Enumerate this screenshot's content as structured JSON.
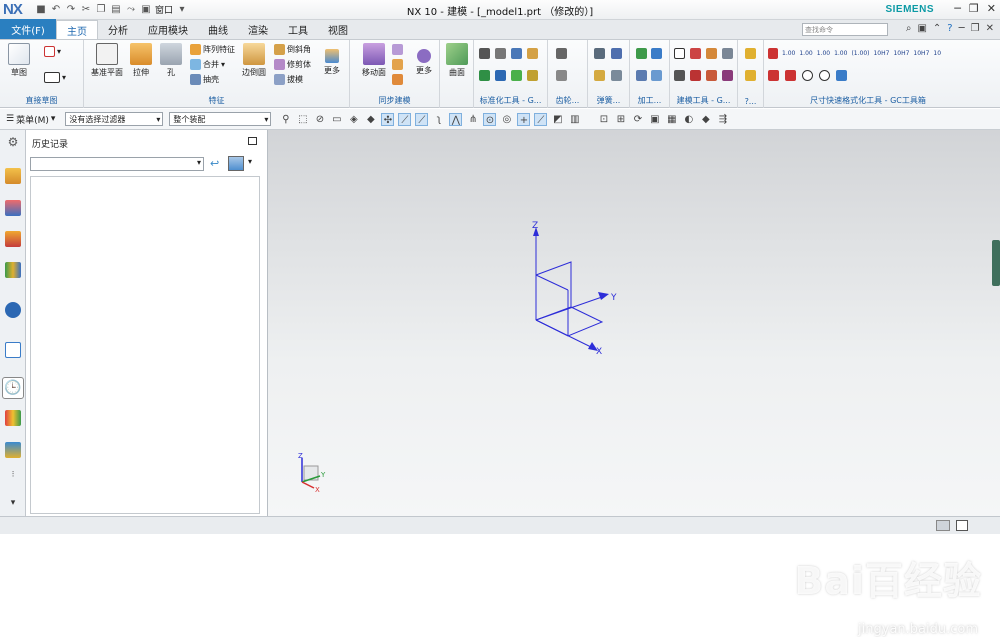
{
  "app": {
    "logo": "NX",
    "window_title": "NX 10 - 建模 - [_model1.prt （修改的）]",
    "brand": "SIEMENS",
    "window_menu_label": "窗口"
  },
  "tabs": {
    "file": "文件(F)",
    "items": [
      "主页",
      "分析",
      "应用模块",
      "曲线",
      "渲染",
      "工具",
      "视图"
    ],
    "active": "主页"
  },
  "command_search": {
    "placeholder": "查找命令"
  },
  "ribbon": {
    "sketch_group": {
      "label": "直接草图",
      "sketch_btn": "草图"
    },
    "feature_group": {
      "label": "特征",
      "datum_plane": "基准平面",
      "extrude": "拉伸",
      "hole": "孔",
      "pattern": "阵列特征",
      "unite": "合并",
      "shell": "抽壳",
      "edge_blend": "边倒圆",
      "chamfer": "倒斜角",
      "trim_body": "修剪体",
      "draft": "拔模",
      "more": "更多"
    },
    "sync_group": {
      "label": "同步建模",
      "move_face": "移动面",
      "more": "更多"
    },
    "surface_group": {
      "surface": "曲面"
    },
    "std_tools_label": "标准化工具 - G...",
    "gear_label": "齿轮...",
    "spring_label": "弹簧...",
    "machining_label": "加工...",
    "modeling_tools_label": "建模工具 - G...",
    "more_label": "?...",
    "dim_label": "尺寸快速格式化工具 - GC工具箱",
    "dim_values": [
      "1.00",
      "1.00",
      "1.00",
      "1.00",
      "(1.00)",
      "10H7",
      "10H7",
      "10H7",
      "10"
    ]
  },
  "toolbar": {
    "menu": "菜单(M)",
    "filter": "没有选择过滤器",
    "assembly": "整个装配"
  },
  "history_panel": {
    "title": "历史记录"
  },
  "triad": {
    "x": "X",
    "y": "Y",
    "z": "Z"
  },
  "mini_triad": {
    "x": "X",
    "y": "Y",
    "z": "Z"
  },
  "watermark": {
    "text": "Bai百经验",
    "url": "jingyan.baidu.com"
  },
  "colors": {
    "accent": "#2a7fc0",
    "csys_blue": "#2d2dd8",
    "brand": "#0c9aa5"
  }
}
